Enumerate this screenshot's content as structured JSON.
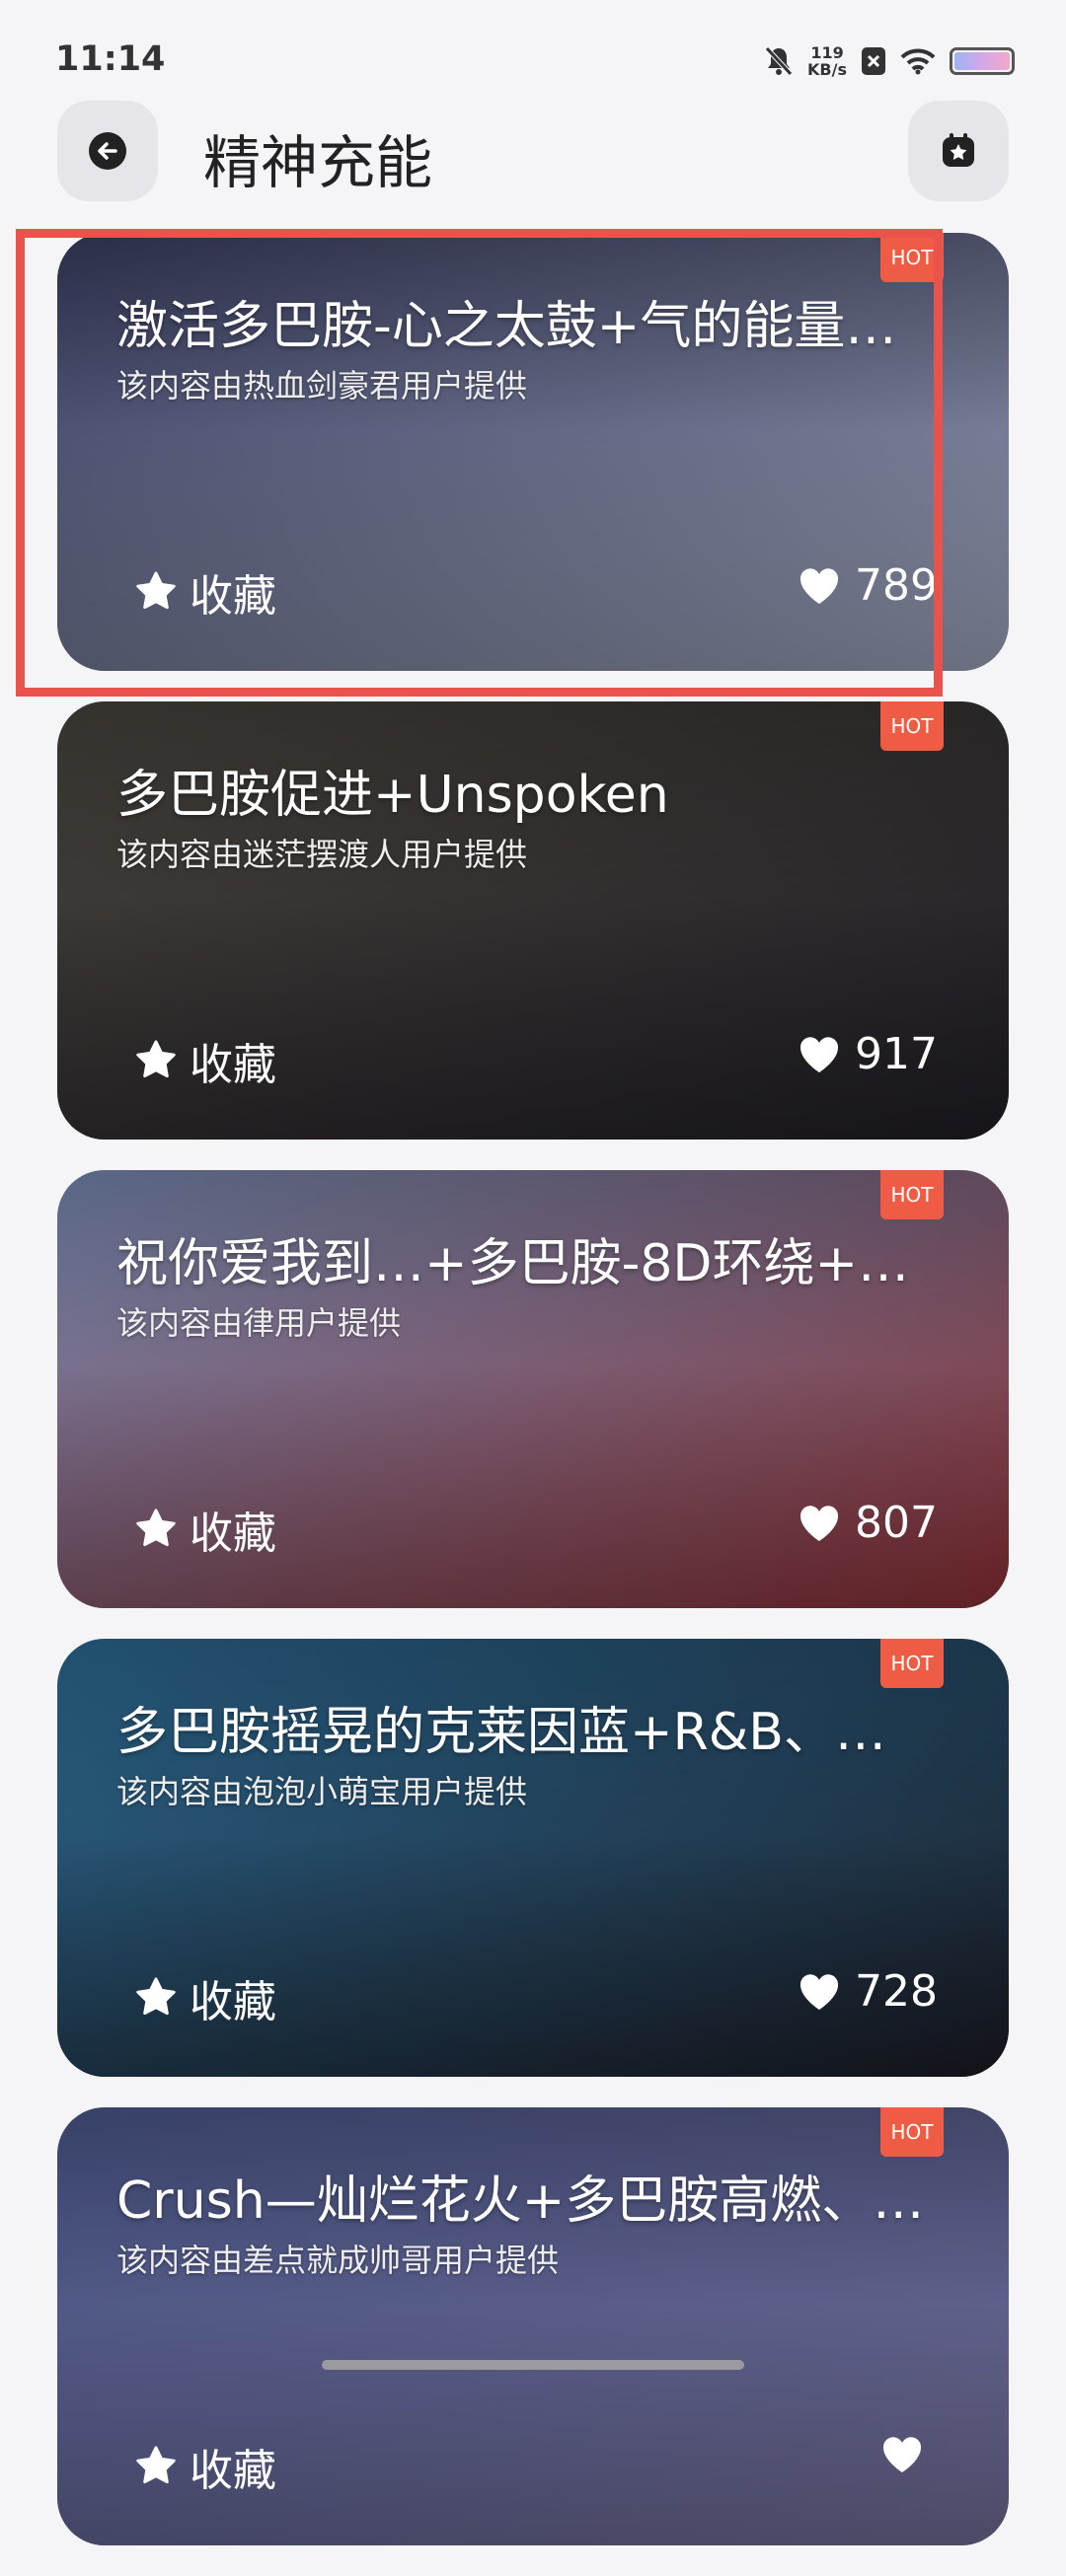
{
  "status_bar": {
    "time": "11:14",
    "net_speed": "119",
    "net_unit": "KB/s"
  },
  "header": {
    "title": "精神充能",
    "back_icon": "arrow-left-icon",
    "fav_icon": "bookmark-star-icon"
  },
  "hot_label": "HOT",
  "fav_label": "收藏",
  "cards": [
    {
      "title": "激活多巴胺-心之太鼓+气的能量…",
      "subtitle": "该内容由热血剑豪君用户提供",
      "likes": "789",
      "colors": [
        "#3a3f63",
        "#9aa1b8"
      ]
    },
    {
      "title": "多巴胺促进+Unspoken",
      "subtitle": "该内容由迷茫摆渡人用户提供",
      "likes": "917",
      "colors": [
        "#4a4640",
        "#1f1d24"
      ]
    },
    {
      "title": "祝你爱我到…+多巴胺-8D环绕+…",
      "subtitle": "该内容由律用户提供",
      "likes": "807",
      "colors": [
        "#7b8fb8",
        "#8a2f33"
      ]
    },
    {
      "title": "多巴胺摇晃的克莱因蓝+R&B、…",
      "subtitle": "该内容由泡泡小萌宝用户提供",
      "likes": "728",
      "colors": [
        "#2e6f9a",
        "#1a1a22"
      ]
    },
    {
      "title": "Crush—灿烂花火+多巴胺高燃、…",
      "subtitle": "该内容由差点就成帅哥用户提供",
      "likes": "",
      "colors": [
        "#4d5a8e",
        "#6e6a92"
      ]
    }
  ]
}
